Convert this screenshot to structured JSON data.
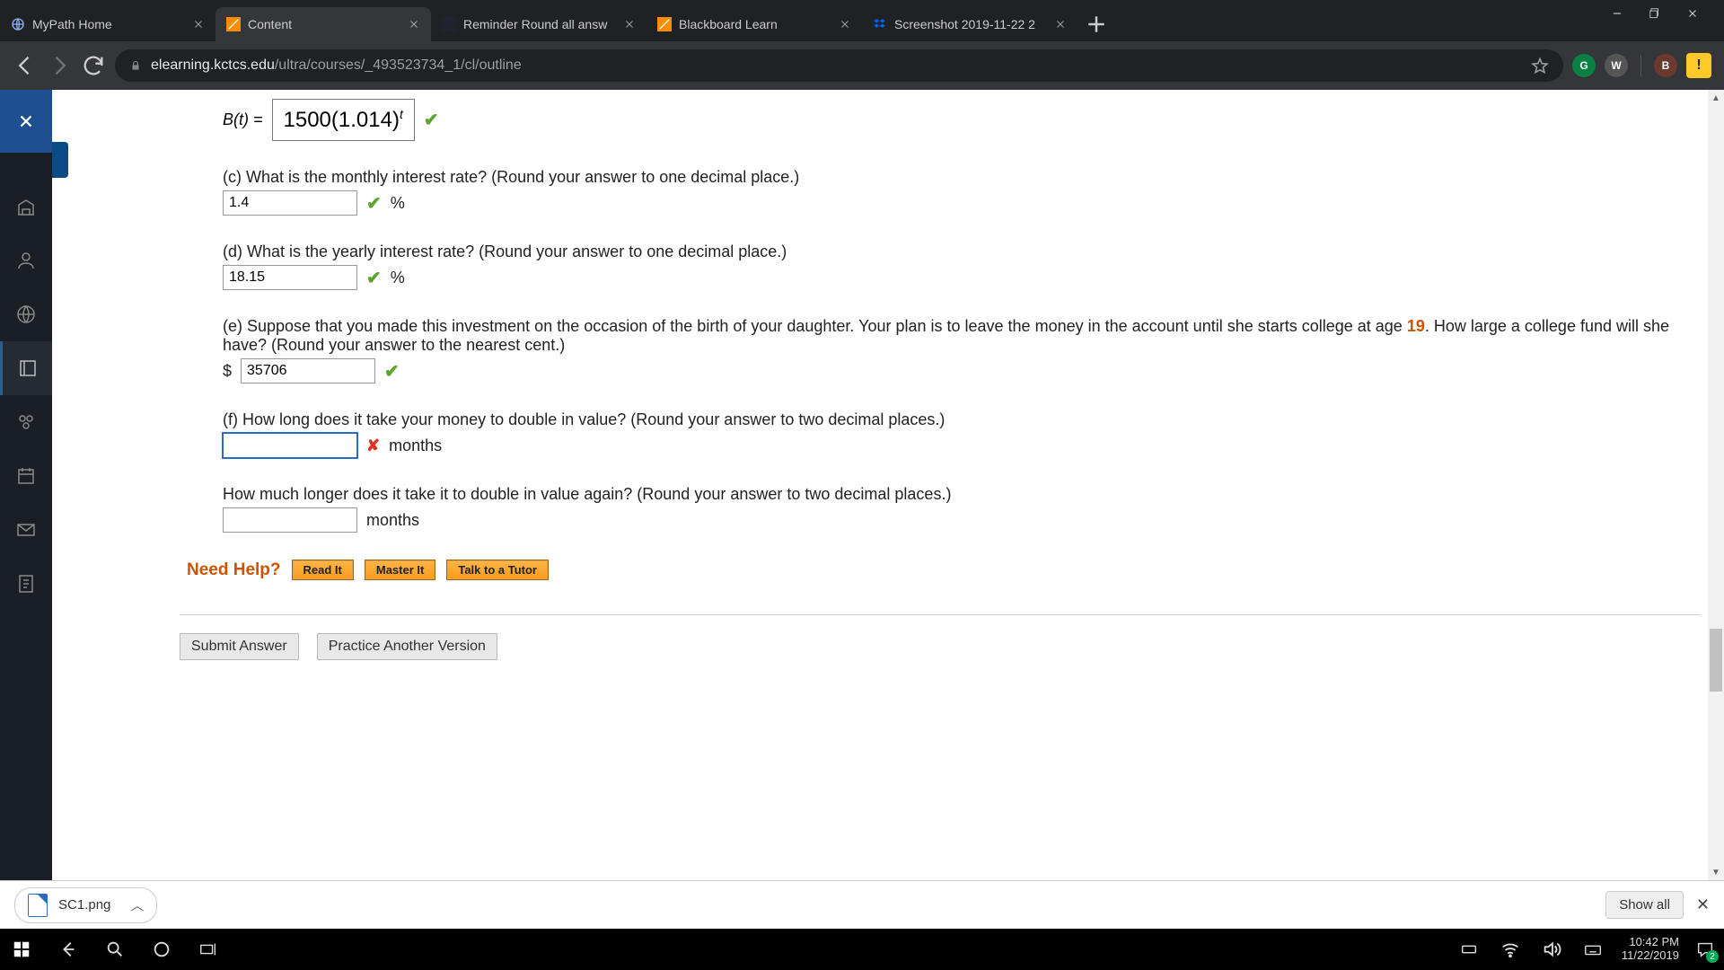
{
  "tabs": [
    {
      "title": "MyPath Home"
    },
    {
      "title": "Content"
    },
    {
      "title": "Reminder Round all answ"
    },
    {
      "title": "Blackboard Learn"
    },
    {
      "title": "Screenshot 2019-11-22 2"
    }
  ],
  "url": {
    "domain": "elearning.kctcs.edu",
    "path": "/ultra/courses/_493523734_1/cl/outline"
  },
  "formula": {
    "lhs": "B(t) =",
    "expr": "1500(1.014)",
    "sup": "t"
  },
  "q_c": {
    "prompt": "(c) What is the monthly interest rate? (Round your answer to one decimal place.)",
    "value": "1.4",
    "unit": "%"
  },
  "q_d": {
    "prompt": "(d) What is the yearly interest rate? (Round your answer to one decimal place.)",
    "value": "18.15",
    "unit": "%"
  },
  "q_e": {
    "prompt_a": "(e) Suppose that you made this investment on the occasion of the birth of your daughter. Your plan is to leave the money in the account until she starts college at age ",
    "age": "19",
    "prompt_b": ". How large a college fund will she have? (Round your answer to the nearest cent.)",
    "prefix": "$",
    "value": "35706"
  },
  "q_f": {
    "prompt": "(f) How long does it take your money to double in value? (Round your answer to two decimal places.)",
    "value": "",
    "unit": "months"
  },
  "q_g": {
    "prompt": "How much longer does it take it to double in value again? (Round your answer to two decimal places.)",
    "value": "",
    "unit": "months"
  },
  "need_help": {
    "label": "Need Help?",
    "read": "Read It",
    "master": "Master It",
    "tutor": "Talk to a Tutor"
  },
  "buttons": {
    "submit": "Submit Answer",
    "practice": "Practice Another Version"
  },
  "download": {
    "file": "SC1.png",
    "show_all": "Show all"
  },
  "ext": {
    "g": "G",
    "w": "W",
    "b": "B",
    "bang": "!"
  },
  "clock": {
    "time": "10:42 PM",
    "date": "11/22/2019"
  },
  "notif_count": "2"
}
